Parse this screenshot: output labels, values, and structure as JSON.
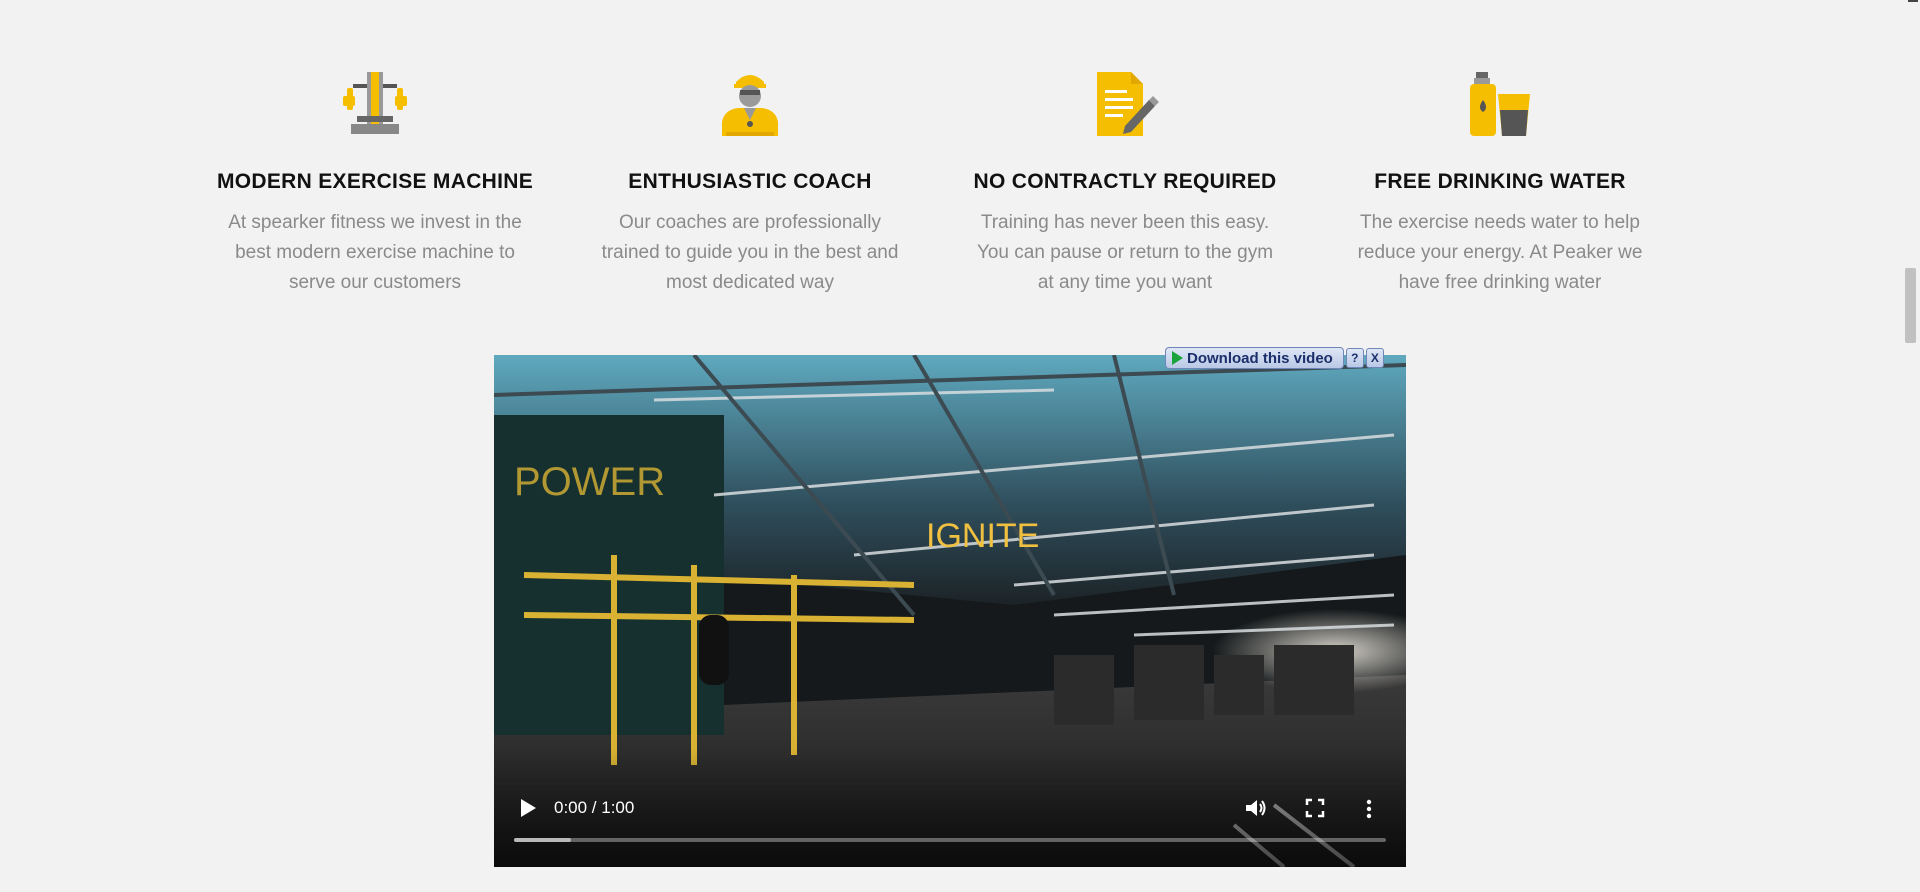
{
  "features": [
    {
      "icon": "exercise-machine-icon",
      "title": "MODERN EXERCISE MACHINE",
      "description": "At spearker fitness we invest in the best modern exercise machine to serve our customers"
    },
    {
      "icon": "coach-icon",
      "title": "ENTHUSIASTIC COACH",
      "description": "Our coaches are professionally trained to guide you in the best and most dedicated way"
    },
    {
      "icon": "contract-icon",
      "title": "NO CONTRACTLY REQUIRED",
      "description": "Training has never been this easy. You can pause or return to the gym at any time you want"
    },
    {
      "icon": "water-bottle-icon",
      "title": "FREE DRINKING WATER",
      "description": "The exercise needs water to help reduce your energy. At Peaker we have free drinking water"
    }
  ],
  "video": {
    "time_display": "0:00 / 1:00",
    "progress_fraction": 0,
    "buffered_fraction": 0.065,
    "neon_sign": "IGNITE",
    "wall_sign": "POWER"
  },
  "download_bar": {
    "label": "Download this video",
    "help_label": "?",
    "close_label": "X"
  },
  "colors": {
    "accent": "#f6be00",
    "icon_gray": "#555555",
    "heading": "#111111",
    "body_text": "#8a8a8a",
    "background": "#f2f2f2"
  }
}
